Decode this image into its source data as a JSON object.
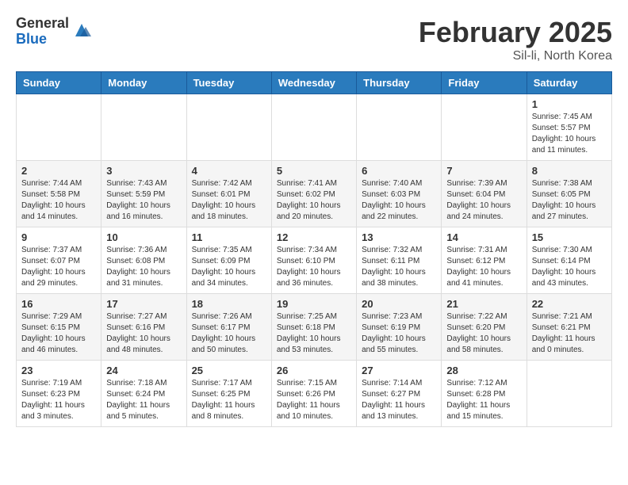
{
  "header": {
    "logo": {
      "general": "General",
      "blue": "Blue"
    },
    "title": "February 2025",
    "subtitle": "Sil-li, North Korea"
  },
  "calendar": {
    "headers": [
      "Sunday",
      "Monday",
      "Tuesday",
      "Wednesday",
      "Thursday",
      "Friday",
      "Saturday"
    ],
    "weeks": [
      [
        {
          "day": "",
          "info": ""
        },
        {
          "day": "",
          "info": ""
        },
        {
          "day": "",
          "info": ""
        },
        {
          "day": "",
          "info": ""
        },
        {
          "day": "",
          "info": ""
        },
        {
          "day": "",
          "info": ""
        },
        {
          "day": "1",
          "info": "Sunrise: 7:45 AM\nSunset: 5:57 PM\nDaylight: 10 hours\nand 11 minutes."
        }
      ],
      [
        {
          "day": "2",
          "info": "Sunrise: 7:44 AM\nSunset: 5:58 PM\nDaylight: 10 hours\nand 14 minutes."
        },
        {
          "day": "3",
          "info": "Sunrise: 7:43 AM\nSunset: 5:59 PM\nDaylight: 10 hours\nand 16 minutes."
        },
        {
          "day": "4",
          "info": "Sunrise: 7:42 AM\nSunset: 6:01 PM\nDaylight: 10 hours\nand 18 minutes."
        },
        {
          "day": "5",
          "info": "Sunrise: 7:41 AM\nSunset: 6:02 PM\nDaylight: 10 hours\nand 20 minutes."
        },
        {
          "day": "6",
          "info": "Sunrise: 7:40 AM\nSunset: 6:03 PM\nDaylight: 10 hours\nand 22 minutes."
        },
        {
          "day": "7",
          "info": "Sunrise: 7:39 AM\nSunset: 6:04 PM\nDaylight: 10 hours\nand 24 minutes."
        },
        {
          "day": "8",
          "info": "Sunrise: 7:38 AM\nSunset: 6:05 PM\nDaylight: 10 hours\nand 27 minutes."
        }
      ],
      [
        {
          "day": "9",
          "info": "Sunrise: 7:37 AM\nSunset: 6:07 PM\nDaylight: 10 hours\nand 29 minutes."
        },
        {
          "day": "10",
          "info": "Sunrise: 7:36 AM\nSunset: 6:08 PM\nDaylight: 10 hours\nand 31 minutes."
        },
        {
          "day": "11",
          "info": "Sunrise: 7:35 AM\nSunset: 6:09 PM\nDaylight: 10 hours\nand 34 minutes."
        },
        {
          "day": "12",
          "info": "Sunrise: 7:34 AM\nSunset: 6:10 PM\nDaylight: 10 hours\nand 36 minutes."
        },
        {
          "day": "13",
          "info": "Sunrise: 7:32 AM\nSunset: 6:11 PM\nDaylight: 10 hours\nand 38 minutes."
        },
        {
          "day": "14",
          "info": "Sunrise: 7:31 AM\nSunset: 6:12 PM\nDaylight: 10 hours\nand 41 minutes."
        },
        {
          "day": "15",
          "info": "Sunrise: 7:30 AM\nSunset: 6:14 PM\nDaylight: 10 hours\nand 43 minutes."
        }
      ],
      [
        {
          "day": "16",
          "info": "Sunrise: 7:29 AM\nSunset: 6:15 PM\nDaylight: 10 hours\nand 46 minutes."
        },
        {
          "day": "17",
          "info": "Sunrise: 7:27 AM\nSunset: 6:16 PM\nDaylight: 10 hours\nand 48 minutes."
        },
        {
          "day": "18",
          "info": "Sunrise: 7:26 AM\nSunset: 6:17 PM\nDaylight: 10 hours\nand 50 minutes."
        },
        {
          "day": "19",
          "info": "Sunrise: 7:25 AM\nSunset: 6:18 PM\nDaylight: 10 hours\nand 53 minutes."
        },
        {
          "day": "20",
          "info": "Sunrise: 7:23 AM\nSunset: 6:19 PM\nDaylight: 10 hours\nand 55 minutes."
        },
        {
          "day": "21",
          "info": "Sunrise: 7:22 AM\nSunset: 6:20 PM\nDaylight: 10 hours\nand 58 minutes."
        },
        {
          "day": "22",
          "info": "Sunrise: 7:21 AM\nSunset: 6:21 PM\nDaylight: 11 hours\nand 0 minutes."
        }
      ],
      [
        {
          "day": "23",
          "info": "Sunrise: 7:19 AM\nSunset: 6:23 PM\nDaylight: 11 hours\nand 3 minutes."
        },
        {
          "day": "24",
          "info": "Sunrise: 7:18 AM\nSunset: 6:24 PM\nDaylight: 11 hours\nand 5 minutes."
        },
        {
          "day": "25",
          "info": "Sunrise: 7:17 AM\nSunset: 6:25 PM\nDaylight: 11 hours\nand 8 minutes."
        },
        {
          "day": "26",
          "info": "Sunrise: 7:15 AM\nSunset: 6:26 PM\nDaylight: 11 hours\nand 10 minutes."
        },
        {
          "day": "27",
          "info": "Sunrise: 7:14 AM\nSunset: 6:27 PM\nDaylight: 11 hours\nand 13 minutes."
        },
        {
          "day": "28",
          "info": "Sunrise: 7:12 AM\nSunset: 6:28 PM\nDaylight: 11 hours\nand 15 minutes."
        },
        {
          "day": "",
          "info": ""
        }
      ]
    ]
  }
}
